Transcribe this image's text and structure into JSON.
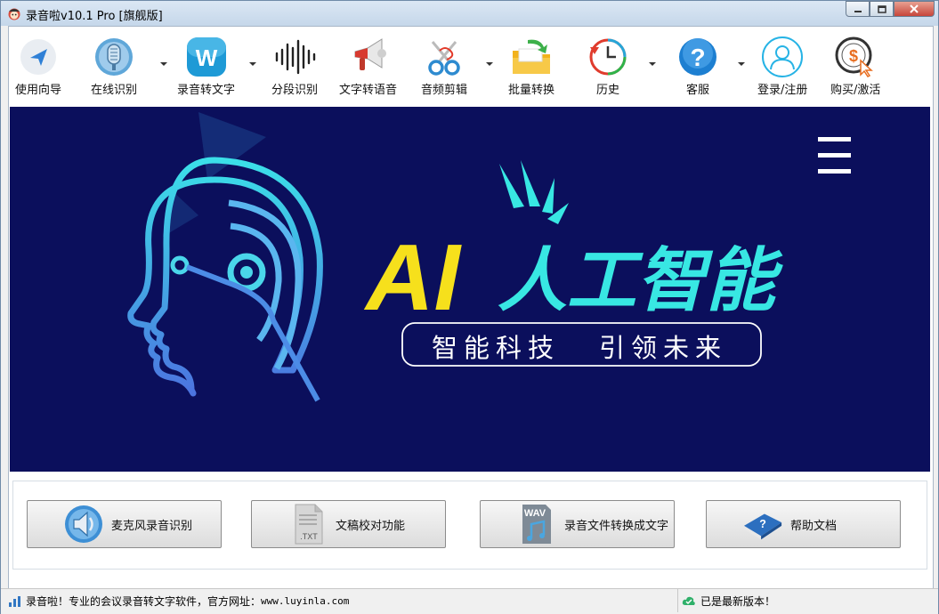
{
  "window": {
    "title": "录音啦v10.1 Pro [旗舰版]"
  },
  "toolbar": {
    "items": [
      {
        "label": "使用向导",
        "icon": "navigation-arrow-icon"
      },
      {
        "label": "在线识别",
        "icon": "microphone-icon",
        "has_dropdown": true
      },
      {
        "label": "录音转文字",
        "icon": "w-letter-icon",
        "has_dropdown": true
      },
      {
        "label": "分段识别",
        "icon": "waveform-icon"
      },
      {
        "label": "文字转语音",
        "icon": "megaphone-icon"
      },
      {
        "label": "音频剪辑",
        "icon": "scissors-icon",
        "has_dropdown": true
      },
      {
        "label": "批量转换",
        "icon": "folder-arrow-icon"
      },
      {
        "label": "历史",
        "icon": "history-clock-icon",
        "has_dropdown": true
      },
      {
        "label": "客服",
        "icon": "help-question-icon",
        "has_dropdown": true
      },
      {
        "label": "登录/注册",
        "icon": "user-icon"
      },
      {
        "label": "购买/激活",
        "icon": "dollar-coin-icon"
      }
    ]
  },
  "banner": {
    "headline_ai": "AI",
    "headline_rest": "人工智能",
    "subtitle_left": "智能科技",
    "subtitle_right": "引领未来",
    "menu_icon": "hamburger-menu-icon"
  },
  "actions": [
    {
      "label": "麦克风录音识别",
      "icon": "speaker-icon"
    },
    {
      "label": "文稿校对功能",
      "icon": "txt-file-icon"
    },
    {
      "label": "录音文件转换成文字",
      "icon": "wav-file-icon"
    },
    {
      "label": "帮助文档",
      "icon": "help-book-icon"
    }
  ],
  "status": {
    "left_text": "录音啦！专业的会议录音转文字软件，官方网址：",
    "url": "www.luyinla.com",
    "right_text": "已是最新版本！"
  },
  "colors": {
    "banner_bg": "#0b0f5c",
    "ai_yellow": "#f6e01c",
    "cyan": "#38e7e3"
  }
}
